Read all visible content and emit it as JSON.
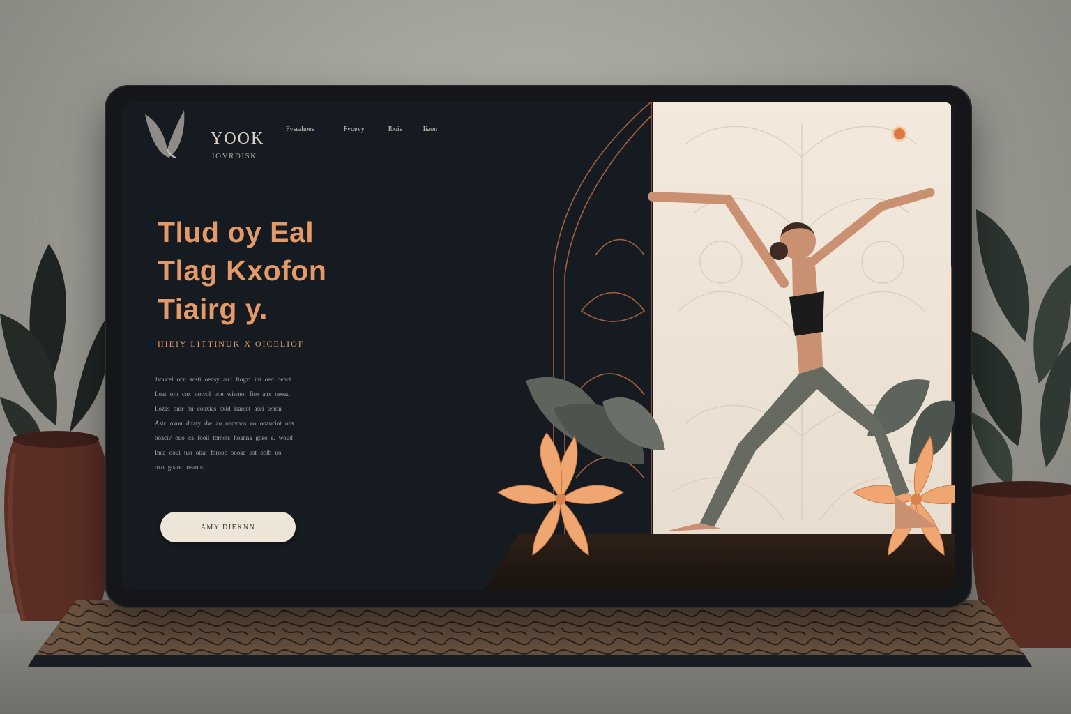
{
  "brand": {
    "name": "YOOK",
    "tagline": "IOVRDISK"
  },
  "nav": {
    "items": [
      "Fvsrahoes",
      "Fvoevy",
      "Ibois",
      "Iiaon"
    ]
  },
  "hero": {
    "headline": [
      "Tlud oy Eal",
      "Tlag  Kxofon",
      "Tiairg y."
    ],
    "subheadline": "HIEIY LITTINUK X OICELIOF",
    "body_lines": [
      "Jsoucel ocn sosti oedsy atcl fiogxt ini oed oenct",
      "Loat orn cnx ootvol ooe wiwnot fise anx oeeau",
      "Lozas onir hu cooxias sxid isarsot asei tenon",
      "Astc ovou dtraty dw ao oncvnos oo ooanciot oos",
      "ooaciv ouo ca fooil tomots hoanna goso s. woud",
      "Inca ooui tuo otiat forooc oooae sot ooib uo",
      "oxo goanc oeaouo."
    ],
    "cta_label": "AMY DIEKNN"
  },
  "colors": {
    "accent": "#e39a68",
    "menu_dot": "#e0773e",
    "screen_bg": "#161b22",
    "cta_bg": "#ede6d8"
  },
  "icons": {
    "logo": "dove-logo-icon",
    "menu": "menu-dot-icon"
  }
}
